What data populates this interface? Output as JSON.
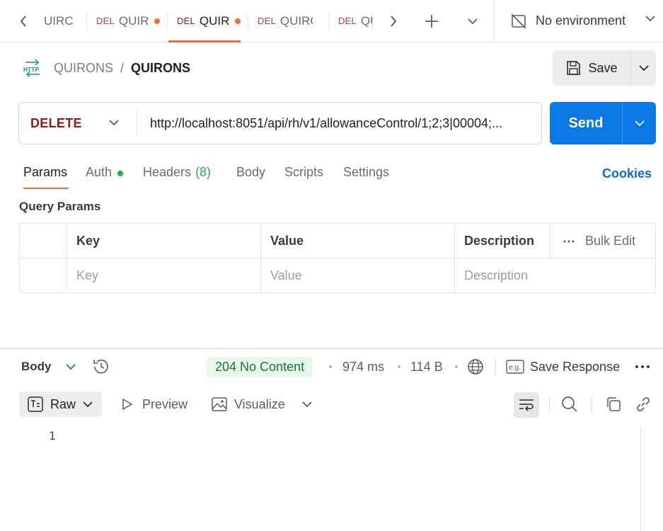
{
  "tabs": [
    {
      "method": "",
      "title": "UIRC",
      "modified": false,
      "active": false
    },
    {
      "method": "DEL",
      "title": "QUIR",
      "modified": true,
      "active": false
    },
    {
      "method": "DEL",
      "title": "QUIR",
      "modified": true,
      "active": true
    },
    {
      "method": "DEL",
      "title": "QUIRC",
      "modified": false,
      "active": false
    },
    {
      "method": "DEL",
      "title": "QU",
      "modified": false,
      "active": false
    }
  ],
  "environment": {
    "label": "No environment"
  },
  "breadcrumb": {
    "protocol": "HTTP",
    "collection": "QUIRONS",
    "separator": "/",
    "request": "QUIRONS"
  },
  "save": {
    "label": "Save"
  },
  "request": {
    "method": "DELETE",
    "url": "http://localhost:8051/api/rh/v1/allowanceControl/1;2;3|00004;..."
  },
  "send": {
    "label": "Send"
  },
  "request_tabs": {
    "params": "Params",
    "auth": "Auth",
    "headers": "Headers",
    "headers_count": "(8)",
    "body": "Body",
    "scripts": "Scripts",
    "settings": "Settings",
    "cookies": "Cookies"
  },
  "query_params": {
    "title": "Query Params",
    "columns": [
      "Key",
      "Value",
      "Description"
    ],
    "bulk_edit": "Bulk Edit",
    "placeholders": [
      "Key",
      "Value",
      "Description"
    ]
  },
  "response": {
    "body_label": "Body",
    "status": "204 No Content",
    "time": "974 ms",
    "size": "114 B",
    "save_response": "Save Response",
    "status_color": "#127a37"
  },
  "view": {
    "raw": "Raw",
    "preview": "Preview",
    "visualize": "Visualize"
  },
  "editor": {
    "line_numbers": [
      "1"
    ]
  },
  "colors": {
    "accent": "#f26b3a",
    "send": "#0b78e3",
    "delete_method": "#8e1b1b",
    "link": "#0b6ccc",
    "auth_dot": "#1fae4b"
  }
}
